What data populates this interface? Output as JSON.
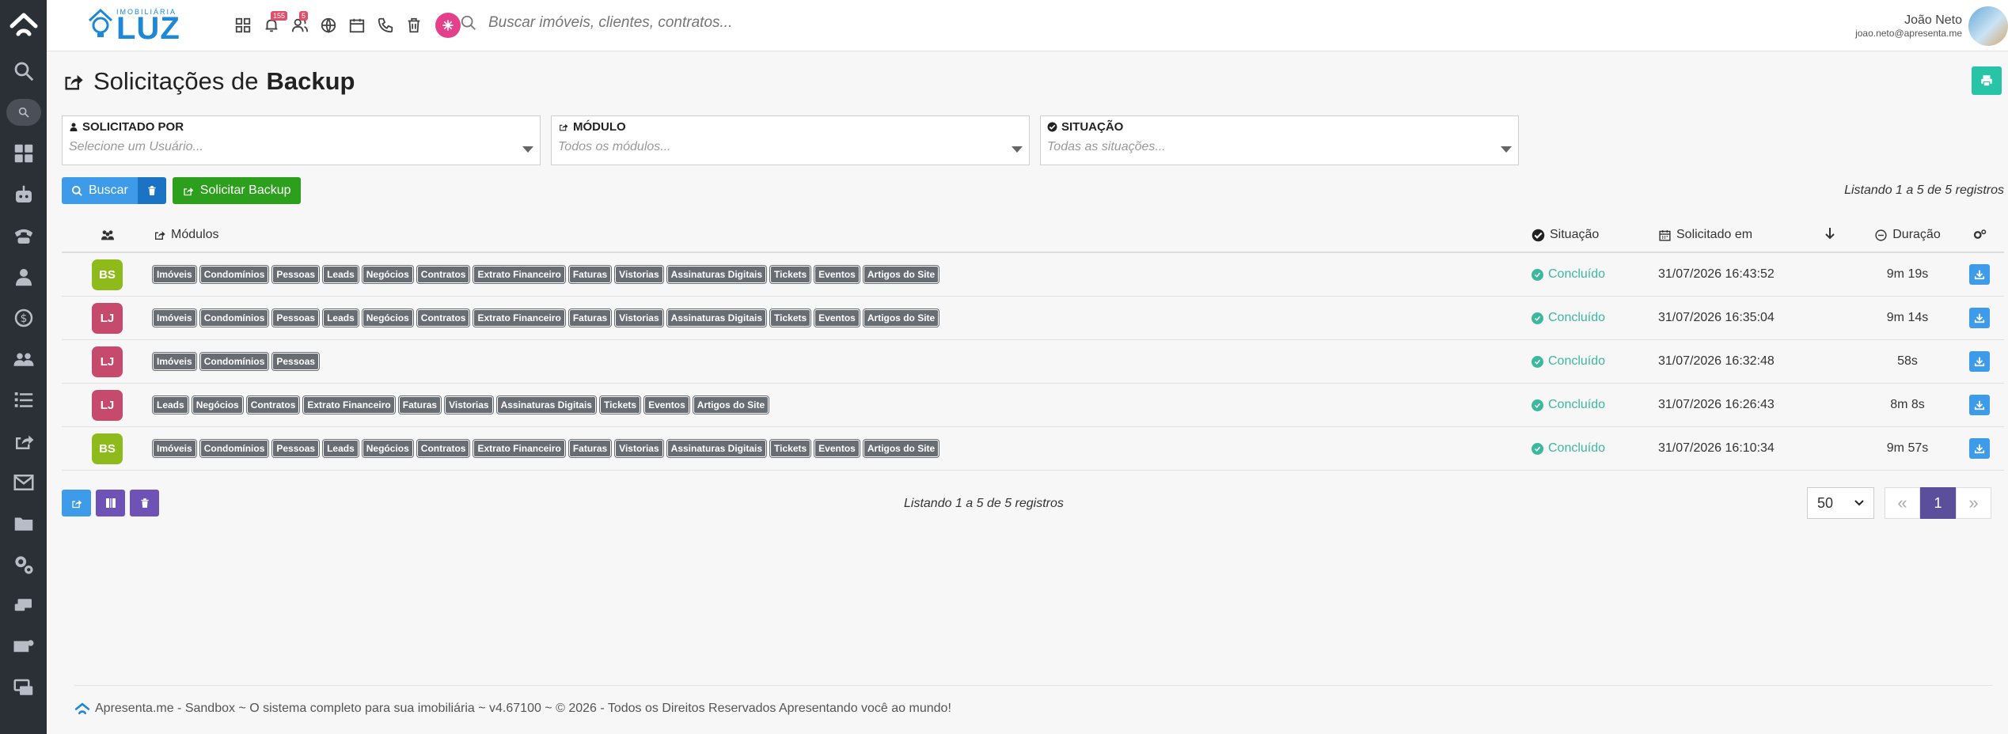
{
  "brand": {
    "small": "IMOBILIÁRIA",
    "big": "LUZ"
  },
  "topbar": {
    "notifications_count": "155",
    "users_count": "5",
    "search_placeholder": "Buscar imóveis, clientes, contratos..."
  },
  "user": {
    "name": "João Neto",
    "email": "joao.neto@apresenta.me"
  },
  "page": {
    "title_prefix": "Solicitações de",
    "title_bold": "Backup"
  },
  "filters": [
    {
      "label": "SOLICITADO POR",
      "placeholder": "Selecione um Usuário..."
    },
    {
      "label": "MÓDULO",
      "placeholder": "Todos os módulos..."
    },
    {
      "label": "SITUAÇÃO",
      "placeholder": "Todas as situações..."
    }
  ],
  "actions": {
    "buscar": "Buscar",
    "solicitar": "Solicitar Backup"
  },
  "listing": "Listando 1 a 5 de 5 registros",
  "table": {
    "headers": {
      "modulos": "Módulos",
      "situacao": "Situação",
      "solicitado_em": "Solicitado em",
      "duracao": "Duração"
    },
    "rows": [
      {
        "initials": "BS",
        "color": "#8fba1c",
        "modules": [
          "Imóveis",
          "Condomínios",
          "Pessoas",
          "Leads",
          "Negócios",
          "Contratos",
          "Extrato Financeiro",
          "Faturas",
          "Vistorias",
          "Assinaturas Digitais",
          "Tickets",
          "Eventos",
          "Artigos do Site"
        ],
        "status": "Concluído",
        "date": "31/07/2026 16:43:52",
        "duration": "9m 19s"
      },
      {
        "initials": "LJ",
        "color": "#c54a6b",
        "modules": [
          "Imóveis",
          "Condomínios",
          "Pessoas",
          "Leads",
          "Negócios",
          "Contratos",
          "Extrato Financeiro",
          "Faturas",
          "Vistorias",
          "Assinaturas Digitais",
          "Tickets",
          "Eventos",
          "Artigos do Site"
        ],
        "status": "Concluído",
        "date": "31/07/2026 16:35:04",
        "duration": "9m 14s"
      },
      {
        "initials": "LJ",
        "color": "#c54a6b",
        "modules": [
          "Imóveis",
          "Condomínios",
          "Pessoas"
        ],
        "status": "Concluído",
        "date": "31/07/2026 16:32:48",
        "duration": "58s"
      },
      {
        "initials": "LJ",
        "color": "#c54a6b",
        "modules": [
          "Leads",
          "Negócios",
          "Contratos",
          "Extrato Financeiro",
          "Faturas",
          "Vistorias",
          "Assinaturas Digitais",
          "Tickets",
          "Eventos",
          "Artigos do Site"
        ],
        "status": "Concluído",
        "date": "31/07/2026 16:26:43",
        "duration": "8m 8s"
      },
      {
        "initials": "BS",
        "color": "#8fba1c",
        "modules": [
          "Imóveis",
          "Condomínios",
          "Pessoas",
          "Leads",
          "Negócios",
          "Contratos",
          "Extrato Financeiro",
          "Faturas",
          "Vistorias",
          "Assinaturas Digitais",
          "Tickets",
          "Eventos",
          "Artigos do Site"
        ],
        "status": "Concluído",
        "date": "31/07/2026 16:10:34",
        "duration": "9m 57s"
      }
    ]
  },
  "pagination": {
    "page_size": "50",
    "current_page": "1"
  },
  "footer": "Apresenta.me - Sandbox ~ O sistema completo para sua imobiliária ~ v4.67100 ~ © 2026 - Todos os Direitos Reservados Apresentando você ao mundo!"
}
